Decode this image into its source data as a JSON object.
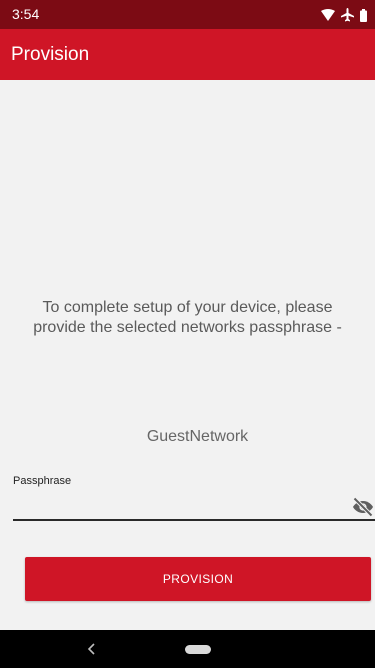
{
  "status_bar": {
    "time": "3:54",
    "icons": [
      "wifi-icon",
      "airplane-mode-icon",
      "battery-icon"
    ]
  },
  "app_bar": {
    "title": "Provision"
  },
  "content": {
    "instructions": "To complete setup of your device, please provide the selected networks passphrase -",
    "network_name": "GuestNetwork"
  },
  "passphrase": {
    "label": "Passphrase",
    "value": "",
    "placeholder": "",
    "visibility_icon": "eye-off-icon"
  },
  "provision_button": {
    "label": "PROVISION"
  },
  "nav_bar": {
    "icons": [
      "back-icon",
      "home-pill-icon"
    ]
  },
  "colors": {
    "status_bar": "#7c0b14",
    "accent": "#cf1526",
    "background": "#f2f2f2",
    "nav_bar": "#000000"
  }
}
